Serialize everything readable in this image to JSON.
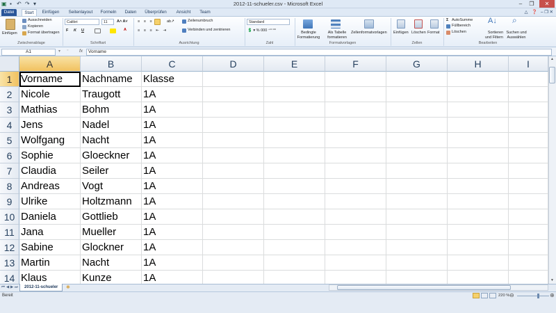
{
  "window": {
    "title": "2012-11-schueler.csv - Microsoft Excel"
  },
  "tabs": [
    {
      "label": "Datei"
    },
    {
      "label": "Start"
    },
    {
      "label": "Einfügen"
    },
    {
      "label": "Seitenlayout"
    },
    {
      "label": "Formeln"
    },
    {
      "label": "Daten"
    },
    {
      "label": "Überprüfen"
    },
    {
      "label": "Ansicht"
    },
    {
      "label": "Team"
    }
  ],
  "ribbon": {
    "clipboard": {
      "paste": "Einfügen",
      "cut": "Ausschneiden",
      "copy": "Kopieren",
      "format_painter": "Format übertragen",
      "group": "Zwischenablage"
    },
    "font": {
      "name": "Calibri",
      "size": "11",
      "bold": "F",
      "italic": "K",
      "underline": "U",
      "group": "Schriftart"
    },
    "alignment": {
      "wrap": "Zeilenumbruch",
      "merge": "Verbinden und zentrieren",
      "group": "Ausrichtung"
    },
    "number": {
      "format": "Standard",
      "group": "Zahl"
    },
    "styles": {
      "conditional_1": "Bedingte",
      "conditional_2": "Formatierung",
      "table_1": "Als Tabelle",
      "table_2": "formatieren",
      "cell_styles": "Zellenformatvorlagen",
      "group": "Formatvorlagen"
    },
    "cells": {
      "insert": "Einfügen",
      "delete": "Löschen",
      "format": "Format",
      "group": "Zellen"
    },
    "editing": {
      "autosum": "AutoSumme",
      "fill": "Füllbereich",
      "clear": "Löschen",
      "sort_1": "Sortieren",
      "sort_2": "und Filtern",
      "find_1": "Suchen und",
      "find_2": "Auswählen",
      "group": "Bearbeiten"
    }
  },
  "formula_bar": {
    "name_box": "A1",
    "fx": "fx",
    "content": "Vorname"
  },
  "grid": {
    "columns": [
      "A",
      "B",
      "C",
      "D",
      "E",
      "F",
      "G",
      "H",
      "I"
    ],
    "rows": [
      {
        "num": "1",
        "cells": [
          "Vorname",
          "Nachname",
          "Klasse"
        ]
      },
      {
        "num": "2",
        "cells": [
          "Nicole",
          "Traugott",
          "1A"
        ]
      },
      {
        "num": "3",
        "cells": [
          "Mathias",
          "Bohm",
          "1A"
        ]
      },
      {
        "num": "4",
        "cells": [
          "Jens",
          "Nadel",
          "1A"
        ]
      },
      {
        "num": "5",
        "cells": [
          "Wolfgang",
          "Nacht",
          "1A"
        ]
      },
      {
        "num": "6",
        "cells": [
          "Sophie",
          "Gloeckner",
          "1A"
        ]
      },
      {
        "num": "7",
        "cells": [
          "Claudia",
          "Seiler",
          "1A"
        ]
      },
      {
        "num": "8",
        "cells": [
          "Andreas",
          "Vogt",
          "1A"
        ]
      },
      {
        "num": "9",
        "cells": [
          "Ulrike",
          "Holtzmann",
          "1A"
        ]
      },
      {
        "num": "10",
        "cells": [
          "Daniela",
          "Gottlieb",
          "1A"
        ]
      },
      {
        "num": "11",
        "cells": [
          "Jana",
          "Mueller",
          "1A"
        ]
      },
      {
        "num": "12",
        "cells": [
          "Sabine",
          "Glockner",
          "1A"
        ]
      },
      {
        "num": "13",
        "cells": [
          "Martin",
          "Nacht",
          "1A"
        ]
      },
      {
        "num": "14",
        "cells": [
          "Klaus",
          "Kunze",
          "1A"
        ]
      }
    ]
  },
  "sheet": {
    "tab": "2012-11-schueler"
  },
  "status": {
    "ready": "Bereit",
    "zoom": "220 %"
  },
  "colors": {
    "file_tab": "#2a5699",
    "selected_header": "#f1c15f",
    "grid_line": "#dadcdd"
  }
}
